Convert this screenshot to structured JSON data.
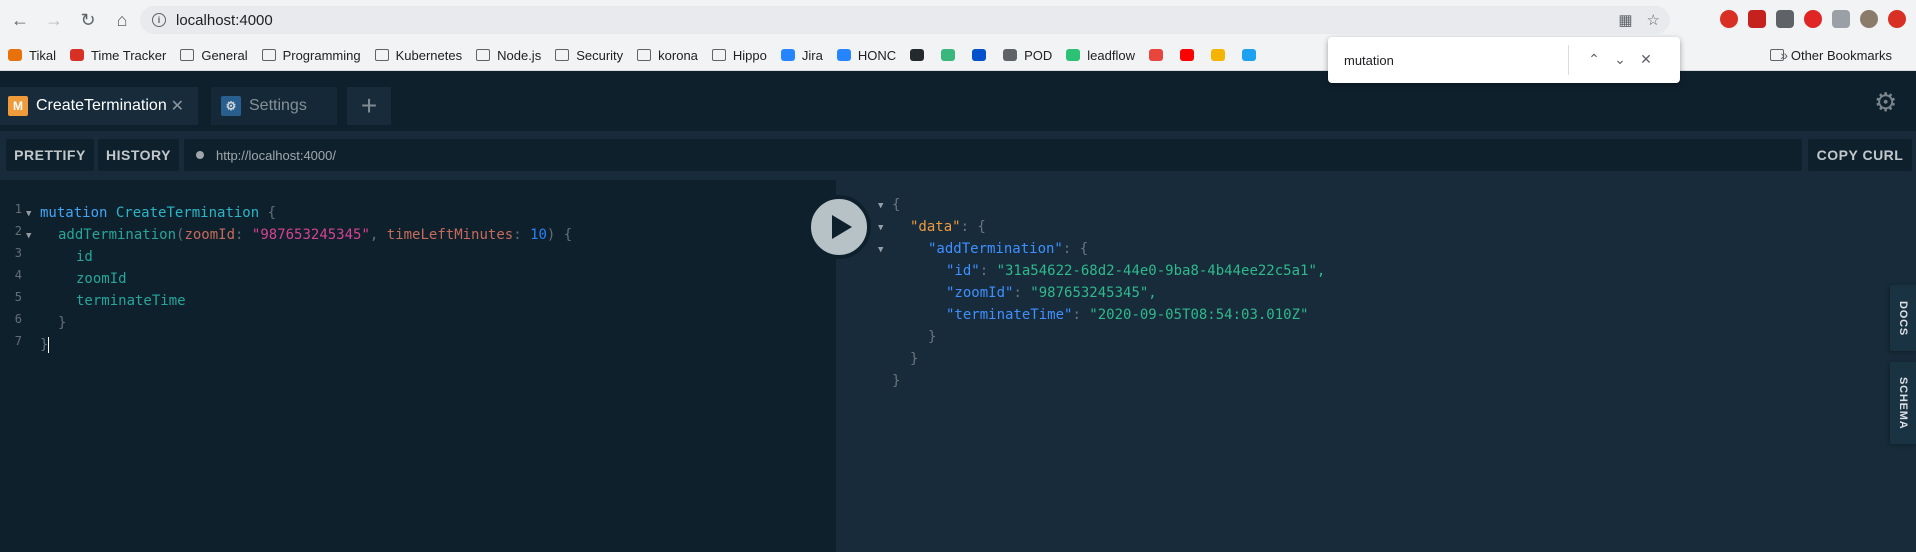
{
  "browser": {
    "url": "localhost:4000",
    "bookmarks": [
      {
        "label": "Tikal",
        "color": "#e8710a",
        "kind": "icon"
      },
      {
        "label": "Time Tracker",
        "color": "#d93025",
        "kind": "icon"
      },
      {
        "label": "General",
        "kind": "folder"
      },
      {
        "label": "Programming",
        "kind": "folder"
      },
      {
        "label": "Kubernetes",
        "kind": "folder"
      },
      {
        "label": "Node.js",
        "kind": "folder"
      },
      {
        "label": "Security",
        "kind": "folder"
      },
      {
        "label": "korona",
        "kind": "folder"
      },
      {
        "label": "Hippo",
        "kind": "folder"
      },
      {
        "label": "Jira",
        "color": "#2684ff",
        "kind": "icon"
      },
      {
        "label": "HONC",
        "color": "#2684ff",
        "kind": "icon"
      },
      {
        "label": "",
        "color": "#24292e",
        "kind": "icon"
      },
      {
        "label": "",
        "color": "#3bb77e",
        "kind": "icon"
      },
      {
        "label": "",
        "color": "#0052cc",
        "kind": "icon"
      },
      {
        "label": "POD",
        "color": "#5f6368",
        "kind": "icon"
      },
      {
        "label": "leadflow",
        "color": "#2bc275",
        "kind": "icon"
      },
      {
        "label": "",
        "color": "#e8453c",
        "kind": "icon"
      },
      {
        "label": "",
        "color": "#ff0000",
        "kind": "icon"
      },
      {
        "label": "",
        "color": "#f4b400",
        "kind": "icon"
      },
      {
        "label": "",
        "color": "#1da1f2",
        "kind": "icon"
      }
    ],
    "other_bookmarks": "Other Bookmarks",
    "find": {
      "query": "mutation"
    }
  },
  "playground": {
    "tabs": [
      {
        "label": "CreateTermination",
        "badge": "M",
        "badge_color": "#f09b3b"
      },
      {
        "label": "Settings",
        "badge_color": "#2f6fa8"
      }
    ],
    "buttons": {
      "prettify": "PRETTIFY",
      "history": "HISTORY",
      "copy_curl": "COPY CURL"
    },
    "endpoint": "http://localhost:4000/",
    "side_tabs": {
      "docs": "DOCS",
      "schema": "SCHEMA"
    },
    "query": {
      "operation_keyword": "mutation",
      "operation_name": "CreateTermination",
      "field": "addTermination",
      "arg1_name": "zoomId",
      "arg1_value": "\"987653245345\"",
      "arg2_name": "timeLeftMinutes",
      "arg2_value": "10",
      "selections": [
        "id",
        "zoomId",
        "terminateTime"
      ],
      "line_numbers": [
        "1",
        "2",
        "3",
        "4",
        "5",
        "6",
        "7"
      ]
    },
    "result": {
      "data_key": "\"data\"",
      "mutation_key": "\"addTermination\"",
      "fields": [
        {
          "key": "\"id\"",
          "value": "\"31a54622-68d2-44e0-9ba8-4b44ee22c5a1\","
        },
        {
          "key": "\"zoomId\"",
          "value": "\"987653245345\","
        },
        {
          "key": "\"terminateTime\"",
          "value": "\"2020-09-05T08:54:03.010Z\""
        }
      ]
    }
  }
}
